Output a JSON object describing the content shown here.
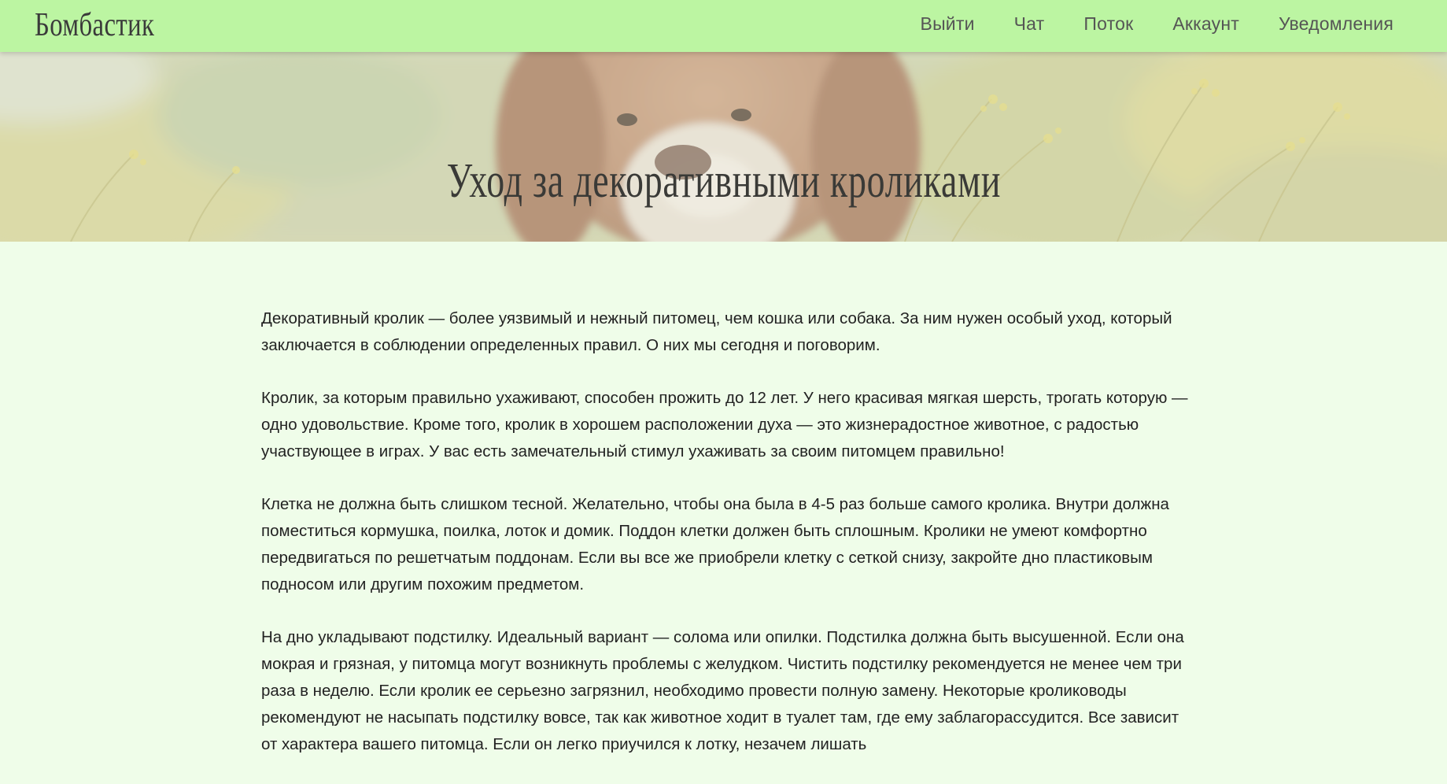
{
  "header": {
    "brand": "Бомбастик",
    "nav": [
      {
        "label": "Выйти"
      },
      {
        "label": "Чат"
      },
      {
        "label": "Поток"
      },
      {
        "label": "Аккаунт"
      },
      {
        "label": "Уведомления"
      }
    ]
  },
  "hero": {
    "title": "Уход за декоративными кроликами",
    "image": "dog-in-meadow-photo"
  },
  "article": {
    "paragraphs": [
      "Декоративный кролик — более уязвимый и нежный питомец, чем кошка или собака. За ним нужен особый уход, который заключается в соблюдении определенных правил. О них мы сегодня и поговорим.",
      "Кролик, за которым правильно ухаживают, способен прожить до 12 лет. У него красивая мягкая шерсть, трогать которую — одно удовольствие. Кроме того, кролик в хорошем расположении духа — это жизнерадостное животное, с радостью участвующее в играх. У вас есть замечательный стимул ухаживать за своим питомцем правильно!",
      "Клетка не должна быть слишком тесной. Желательно, чтобы она была в 4-5 раз больше самого кролика. Внутри должна поместиться кормушка, поилка, лоток и домик. Поддон клетки должен быть сплошным. Кролики не умеют комфортно передвигаться по решетчатым поддонам. Если вы все же приобрели клетку с сеткой снизу, закройте дно пластиковым подносом или другим похожим предметом.",
      "На дно укладывают подстилку. Идеальный вариант — солома или опилки. Подстилка должна быть высушенной. Если она мокрая и грязная, у питомца могут возникнуть проблемы с желудком. Чистить подстилку рекомендуется не менее чем три раза в неделю. Если кролик ее серьезно загрязнил, необходимо провести полную замену. Некоторые кролиководы рекомендуют не насыпать подстилку вовсе, так как животное ходит в туалет там, где ему заблагорассудится. Все зависит от характера вашего питомца. Если он легко приучился к лотку, незачем лишать"
    ]
  },
  "colors": {
    "header_bg": "#bcf5a2",
    "page_bg": "#effde9",
    "text": "#222222"
  }
}
